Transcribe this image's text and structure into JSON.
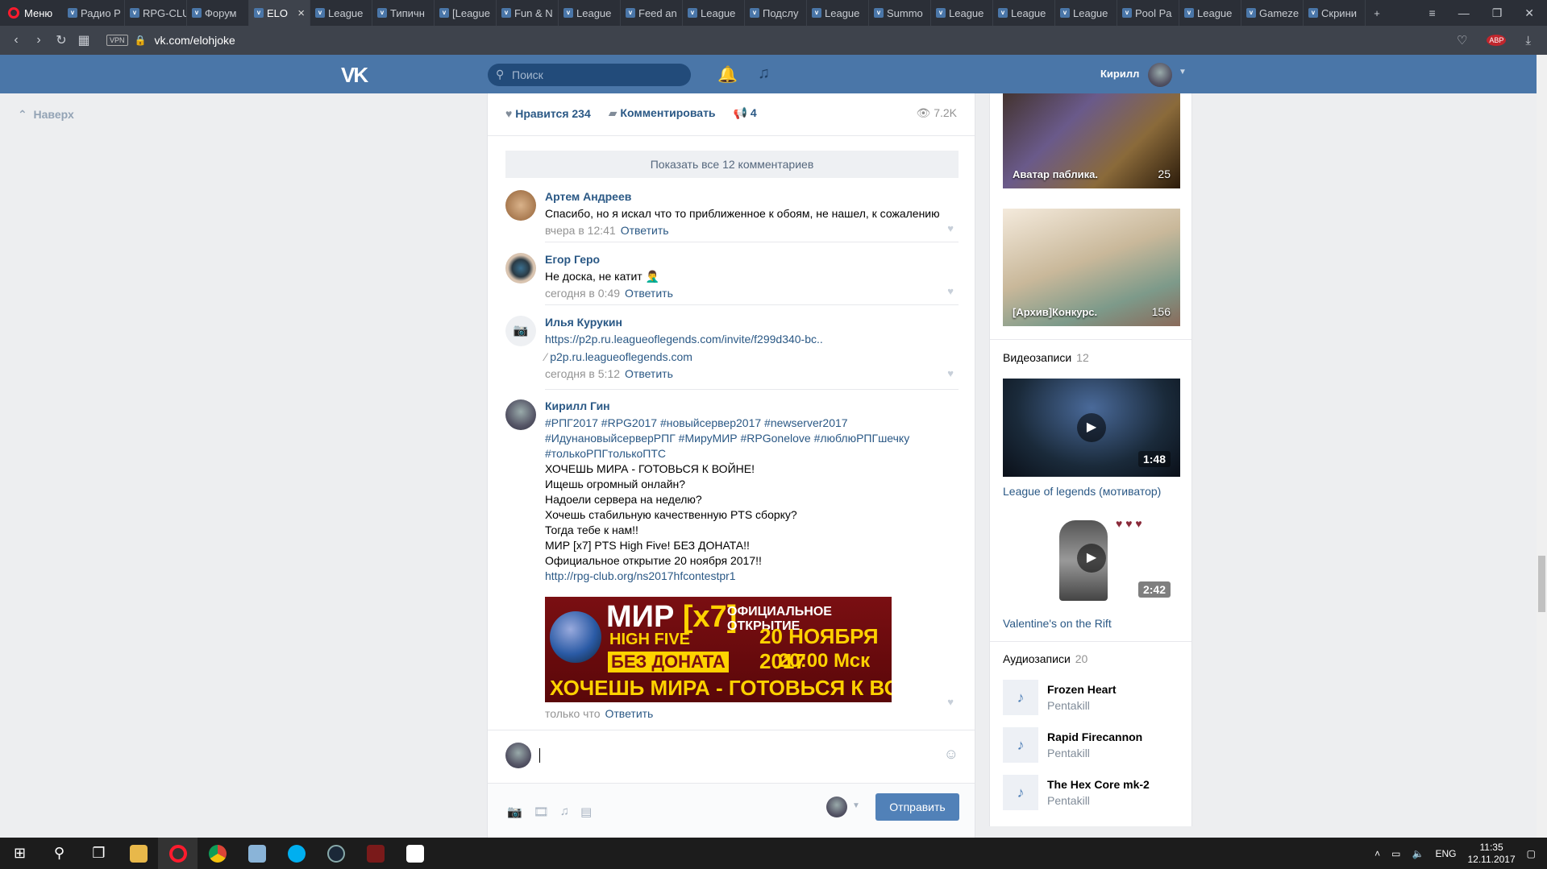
{
  "browser": {
    "menu_label": "Меню",
    "tabs": [
      {
        "label": "Радио Р"
      },
      {
        "label": "RPG-CLU"
      },
      {
        "label": "Форум"
      },
      {
        "label": "ELO",
        "active": true
      },
      {
        "label": "League"
      },
      {
        "label": "Типичн"
      },
      {
        "label": "[League"
      },
      {
        "label": "Fun & N"
      },
      {
        "label": "League"
      },
      {
        "label": "Feed an"
      },
      {
        "label": "League"
      },
      {
        "label": "Подслу"
      },
      {
        "label": "League"
      },
      {
        "label": "Summo"
      },
      {
        "label": "League"
      },
      {
        "label": "League"
      },
      {
        "label": "League"
      },
      {
        "label": "Pool Pa"
      },
      {
        "label": "League"
      },
      {
        "label": "Gameze"
      },
      {
        "label": "Скрини"
      }
    ],
    "address": "vk.com/elohjoke",
    "vpn_label": "VPN",
    "abp_label": "ABP"
  },
  "vk_header": {
    "logo": "VK",
    "search_placeholder": "Поиск",
    "user_name": "Кирилл"
  },
  "left": {
    "back_to_top": "Наверх"
  },
  "post": {
    "like_label": "Нравится",
    "like_count": "234",
    "comment_label": "Комментировать",
    "share_count": "4",
    "views": "7.2K",
    "show_all_comments": "Показать все 12 комментариев",
    "reply_label": "Ответить",
    "comments": [
      {
        "author": "Артем Андреев",
        "text": "Спасибо, но я искал что то приближенное к обоям, не нашел, к сожалению",
        "time": "вчера в 12:41"
      },
      {
        "author": "Егор Геро",
        "text": "Не доска, не катит 🤦‍♂️",
        "time": "сегодня в 0:49"
      },
      {
        "author": "Илья Курукин",
        "text": "https://p2p.ru.leagueoflegends.com/invite/f299d340-bc..",
        "link_domain": "p2p.ru.leagueoflegends.com",
        "time": "сегодня в 5:12"
      },
      {
        "author": "Кирилл Гин",
        "lines": [
          "#РПГ2017 #RPG2017 #новыйсервер2017 #newserver2017",
          "#ИдунановыйсерверРПГ #МируМИР #RPGonelove #люблюРПГшечку",
          "#толькоРПГтолькоПТС",
          "ХОЧЕШЬ МИРА - ГОТОВЬСЯ К ВОЙНЕ!",
          "Ищешь огромный онлайн?",
          "Надоели сервера на неделю?",
          "Хочешь стабильную качественную PTS сборку?",
          "Тогда тебе к нам!!",
          "МИР [x7] PTS High Five! БЕЗ ДОНАТА!!",
          "Официальное открытие 20 ноября 2017!!",
          "http://rpg-club.org/ns2017hfcontestpr1"
        ],
        "banner": {
          "mir": "МИР",
          "x7": "[x7]",
          "high_five": "HIGH FIVE",
          "no_donate": "БЕЗ ДОНАТА",
          "official_opening": "ОФИЦИАЛЬНОЕ ОТКРЫТИЕ",
          "date": "20 НОЯБРЯ 2017",
          "time": "20:00 Мск",
          "motto": "ХОЧЕШЬ МИРА - ГОТОВЬСЯ К ВОЙНЕ"
        },
        "time": "только что"
      }
    ],
    "send_label": "Отправить"
  },
  "sidebar": {
    "albums": [
      {
        "label": "Аватар паблика.",
        "count": "25"
      },
      {
        "label": "[Архив]Конкурс.",
        "count": "156"
      }
    ],
    "videos_title": "Видеозаписи",
    "videos_count": "12",
    "videos": [
      {
        "title": "League of legends (мотиватор)",
        "duration": "1:48"
      },
      {
        "title": "Valentine's on the Rift",
        "duration": "2:42"
      }
    ],
    "audio_title": "Аудиозаписи",
    "audio_count": "20",
    "audios": [
      {
        "title": "Frozen Heart",
        "artist": "Pentakill"
      },
      {
        "title": "Rapid Firecannon",
        "artist": "Pentakill"
      },
      {
        "title": "The Hex Core mk-2",
        "artist": "Pentakill"
      }
    ]
  },
  "taskbar": {
    "lang": "ENG",
    "time": "11:35",
    "date": "12.11.2017"
  }
}
